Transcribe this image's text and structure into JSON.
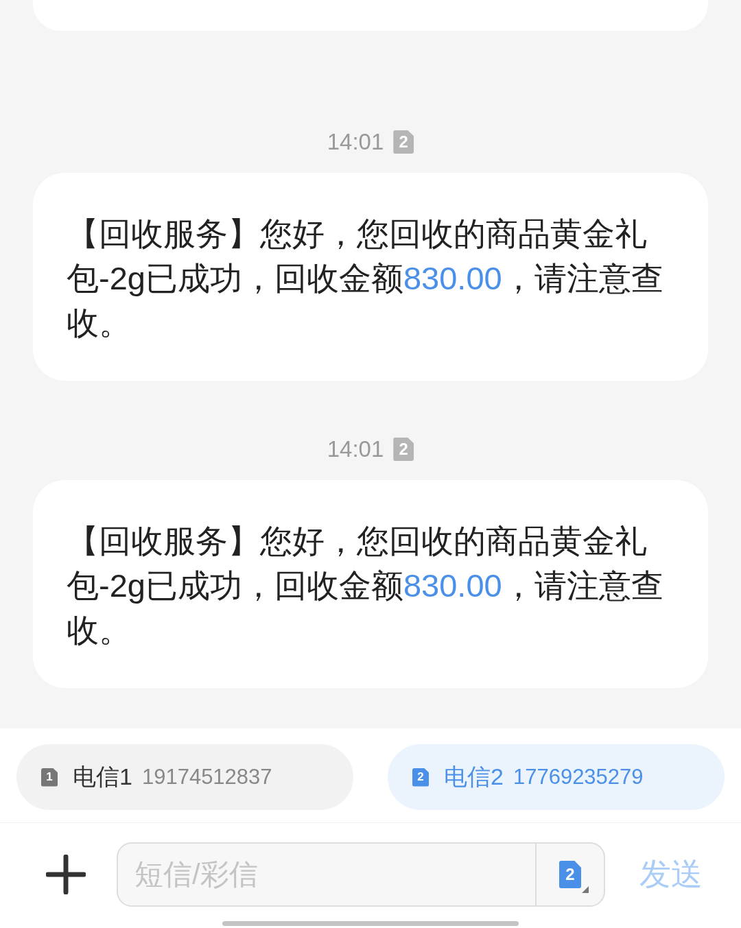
{
  "messages": [
    {
      "time": "14:01",
      "sim_number": "2",
      "text_before": "【回收服务】您好，您回收的商品黄金礼包-2g已成功，回收金额",
      "amount": "830.00",
      "text_after": "，请注意查收。"
    },
    {
      "time": "14:01",
      "sim_number": "2",
      "text_before": "【回收服务】您好，您回收的商品黄金礼包-2g已成功，回收金额",
      "amount": "830.00",
      "text_after": "，请注意查收。"
    }
  ],
  "sim_chips": [
    {
      "sim_number": "1",
      "carrier": "电信1",
      "phone": "19174512837",
      "selected": false
    },
    {
      "sim_number": "2",
      "carrier": "电信2",
      "phone": "17769235279",
      "selected": true
    }
  ],
  "composer": {
    "placeholder": "短信/彩信",
    "sim_number": "2",
    "send_label": "发送"
  }
}
